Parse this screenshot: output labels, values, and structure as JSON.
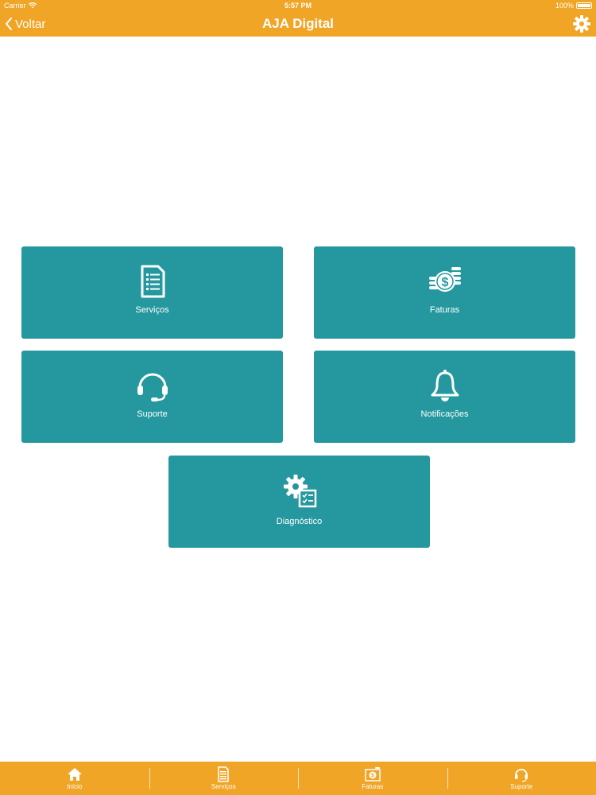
{
  "status_bar": {
    "carrier": "Carrier",
    "time": "5:57 PM",
    "battery": "100%"
  },
  "nav": {
    "back_label": "Voltar",
    "title": "AJA Digital"
  },
  "tiles": [
    {
      "label": "Serviços",
      "icon": "document-list-icon"
    },
    {
      "label": "Faturas",
      "icon": "coins-dollar-icon"
    },
    {
      "label": "Suporte",
      "icon": "headset-icon"
    },
    {
      "label": "Notificações",
      "icon": "bell-icon"
    },
    {
      "label": "Diagnóstico",
      "icon": "gear-checklist-icon"
    }
  ],
  "tabbar": [
    {
      "label": "Início",
      "icon": "home-icon"
    },
    {
      "label": "Serviços",
      "icon": "document-icon"
    },
    {
      "label": "Faturas",
      "icon": "coins-icon"
    },
    {
      "label": "Suporte",
      "icon": "headset-icon"
    }
  ],
  "colors": {
    "accent": "#f0a526",
    "tile": "#24989e",
    "background": "#ffffff"
  }
}
